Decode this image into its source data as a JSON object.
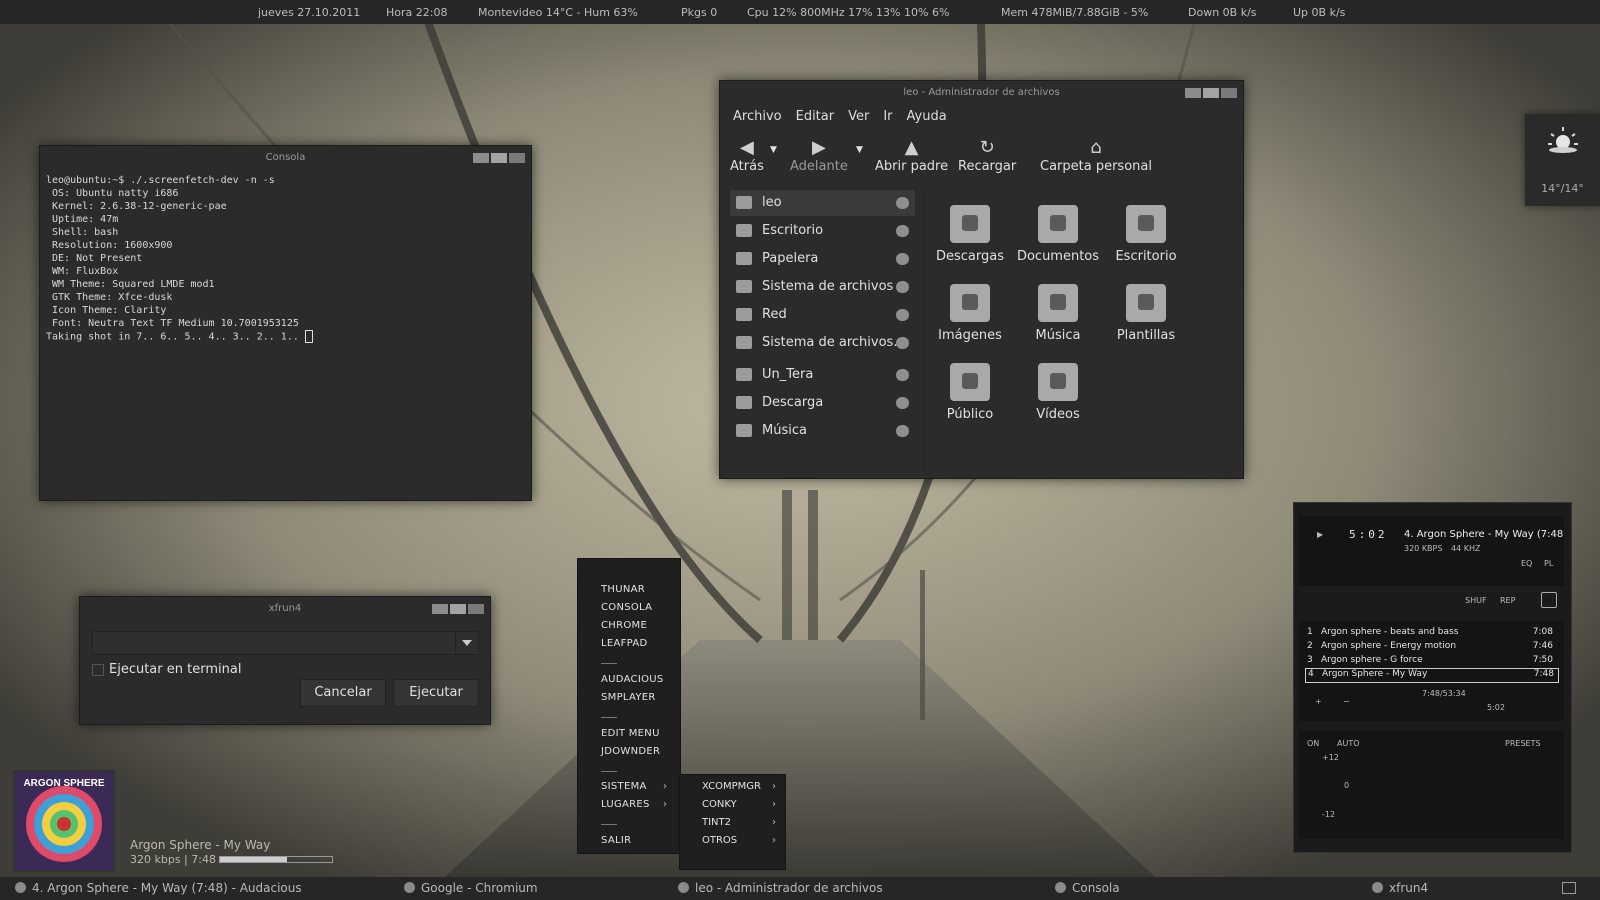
{
  "topbar": {
    "date": "jueves 27.10.2011",
    "time": "Hora 22:08",
    "weather": "Montevideo  14°C - Hum 63%",
    "pkgs": "Pkgs 0",
    "cpu": "Cpu 12%  800MHz  17%  13%  10%  6%",
    "mem": "Mem 478MiB/7.88GiB - 5%",
    "down": "Down 0B  k/s",
    "up": "Up 0B  k/s"
  },
  "console": {
    "title": "Consola",
    "lines": [
      "leo@ubuntu:~$ ./.screenfetch-dev -n -s",
      " OS: Ubuntu natty i686",
      " Kernel: 2.6.38-12-generic-pae",
      " Uptime: 47m",
      " Shell: bash",
      " Resolution: 1600x900",
      " DE: Not Present",
      " WM: FluxBox",
      " WM Theme: Squared LMDE mod1",
      " GTK Theme: Xfce-dusk",
      " Icon Theme: Clarity",
      " Font: Neutra Text TF Medium 10.7001953125",
      "Taking shot in 7.. 6.. 5.. 4.. 3.. 2.. 1.. "
    ]
  },
  "filemanager": {
    "title": "leo - Administrador de archivos",
    "menu": [
      "Archivo",
      "Editar",
      "Ver",
      "Ir",
      "Ayuda"
    ],
    "toolbar": {
      "back": "Atrás",
      "forward": "Adelante",
      "up": "Abrir padre",
      "reload": "Recargar",
      "home": "Carpeta personal"
    },
    "sidebar": [
      {
        "label": "leo",
        "icon": "home-icon"
      },
      {
        "label": "Escritorio",
        "icon": "desktop-icon"
      },
      {
        "label": "Papelera",
        "icon": "trash-icon"
      },
      {
        "label": "Sistema de archivos",
        "icon": "drive-icon"
      },
      {
        "label": "Red",
        "icon": "network-icon"
      },
      {
        "label": "Sistema de archivos...",
        "icon": "drive-icon"
      },
      {
        "label": "Un_Tera",
        "icon": "folder-icon"
      },
      {
        "label": "Descarga",
        "icon": "download-folder-icon"
      },
      {
        "label": "Música",
        "icon": "music-folder-icon"
      }
    ],
    "folders": [
      {
        "label": "Descargas",
        "icon": "downloads-folder-icon"
      },
      {
        "label": "Documentos",
        "icon": "documents-folder-icon"
      },
      {
        "label": "Escritorio",
        "icon": "desktop-folder-icon"
      },
      {
        "label": "Imágenes",
        "icon": "pictures-folder-icon"
      },
      {
        "label": "Música",
        "icon": "music-folder-icon"
      },
      {
        "label": "Plantillas",
        "icon": "templates-folder-icon"
      },
      {
        "label": "Público",
        "icon": "public-folder-icon"
      },
      {
        "label": "Vídeos",
        "icon": "videos-folder-icon"
      }
    ]
  },
  "xfrun": {
    "title": "xfrun4",
    "checkbox": "Ejecutar en terminal",
    "cancel": "Cancelar",
    "run": "Ejecutar"
  },
  "menu": {
    "items": [
      "THUNAR",
      "CONSOLA",
      "CHROME",
      "LEAFPAD",
      "AUDACIOUS",
      "SMPLAYER",
      "EDIT MENU",
      "JDOWNDER",
      "SISTEMA",
      "LUGARES",
      "SALIR"
    ],
    "submenu": [
      "XCOMPMGR",
      "CONKY",
      "TINT2",
      "OTROS"
    ]
  },
  "weather_widget": {
    "temp": "14°/14°"
  },
  "audacious": {
    "time": "5:02",
    "track": "4. Argon Sphere - My Way (7:48",
    "bitrate": "320 KBPS",
    "freq": "44 KHZ",
    "eq": "EQ",
    "pl": "PL",
    "shuf": "SHUF",
    "rep": "REP",
    "playlist": [
      {
        "n": "1",
        "title": "Argon sphere - beats and bass",
        "dur": "7:08"
      },
      {
        "n": "2",
        "title": "Argon sphere - Energy motion",
        "dur": "7:46"
      },
      {
        "n": "3",
        "title": "Argon sphere - G force",
        "dur": "7:50"
      },
      {
        "n": "4",
        "title": "Argon Sphere - My Way",
        "dur": "7:48"
      }
    ],
    "pl_total": "7:48/53:34",
    "pl_time": "5:02",
    "eq_on": "ON",
    "eq_auto": "AUTO",
    "eq_presets": "PRESETS",
    "eq_plus": "+12",
    "eq_zero": "0",
    "eq_minus": "-12"
  },
  "nowplaying": {
    "cover_title": "ARGON SPHERE",
    "title": "Argon Sphere - My Way",
    "info": "320 kbps | 7:48",
    "progress": 0.6
  },
  "taskbar": [
    {
      "label": "4. Argon Sphere - My Way (7:48) - Audacious",
      "icon": "audacious-icon"
    },
    {
      "label": "Google - Chromium",
      "icon": "chromium-icon"
    },
    {
      "label": "leo - Administrador de archivos",
      "icon": "home-icon"
    },
    {
      "label": "Consola",
      "icon": "terminal-icon"
    },
    {
      "label": "xfrun4",
      "icon": "run-icon"
    }
  ]
}
